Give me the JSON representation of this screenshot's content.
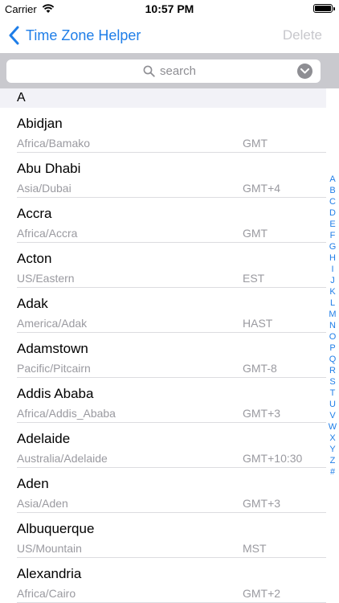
{
  "status_bar": {
    "carrier": "Carrier",
    "time": "10:57 PM",
    "battery_level": 1.0
  },
  "nav": {
    "back_label": "Time Zone Helper",
    "delete_label": "Delete"
  },
  "search": {
    "placeholder": "search"
  },
  "section": {
    "title": "A"
  },
  "rows": [
    {
      "city": "Abidjan",
      "tz": "Africa/Bamako",
      "offset": "GMT"
    },
    {
      "city": "Abu Dhabi",
      "tz": "Asia/Dubai",
      "offset": "GMT+4"
    },
    {
      "city": "Accra",
      "tz": "Africa/Accra",
      "offset": "GMT"
    },
    {
      "city": "Acton",
      "tz": "US/Eastern",
      "offset": "EST"
    },
    {
      "city": "Adak",
      "tz": "America/Adak",
      "offset": "HAST"
    },
    {
      "city": "Adamstown",
      "tz": "Pacific/Pitcairn",
      "offset": "GMT-8"
    },
    {
      "city": "Addis Ababa",
      "tz": "Africa/Addis_Ababa",
      "offset": "GMT+3"
    },
    {
      "city": "Adelaide",
      "tz": "Australia/Adelaide",
      "offset": "GMT+10:30"
    },
    {
      "city": "Aden",
      "tz": "Asia/Aden",
      "offset": "GMT+3"
    },
    {
      "city": "Albuquerque",
      "tz": "US/Mountain",
      "offset": "MST"
    },
    {
      "city": "Alexandria",
      "tz": "Africa/Cairo",
      "offset": "GMT+2"
    }
  ],
  "index_letters": [
    "A",
    "B",
    "C",
    "D",
    "E",
    "F",
    "G",
    "H",
    "I",
    "J",
    "K",
    "L",
    "M",
    "N",
    "O",
    "P",
    "Q",
    "R",
    "S",
    "T",
    "U",
    "V",
    "W",
    "X",
    "Y",
    "Z",
    "#"
  ],
  "colors": {
    "accent": "#1f7ee8",
    "disabled": "#c7c7cc",
    "secondary_text": "#9a9aa0",
    "search_bar_bg": "#c9c9ce"
  }
}
